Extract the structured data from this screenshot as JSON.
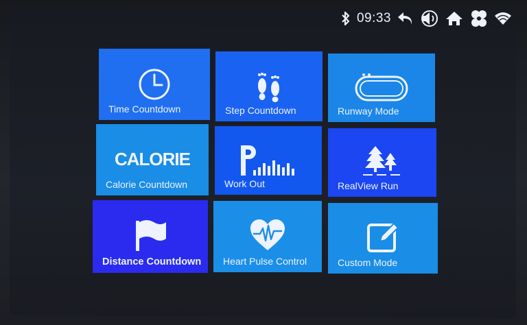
{
  "status_bar": {
    "time": "09:33",
    "icons": [
      "bluetooth-icon",
      "back-icon",
      "volume-icon",
      "home-icon",
      "fan-icon",
      "wifi-icon"
    ]
  },
  "tiles": [
    {
      "label": "Time Countdown",
      "icon": "clock-icon",
      "color": "#1f6ff0"
    },
    {
      "label": "Step Countdown",
      "icon": "footprints-icon",
      "color": "#1a62f2"
    },
    {
      "label": "Runway Mode",
      "icon": "track-icon",
      "color": "#1b86e8"
    },
    {
      "label": "Calorie Countdown",
      "icon": "calorie-icon",
      "icon_text": "CALORIE",
      "color": "#1a8de6"
    },
    {
      "label": "Work Out",
      "icon": "program-bars-icon",
      "color": "#1358ee"
    },
    {
      "label": "RealView Run",
      "icon": "trees-icon",
      "color": "#1b46f2"
    },
    {
      "label": "Distance Countdown",
      "icon": "flag-icon",
      "color": "#2a2bef"
    },
    {
      "label": "Heart Pulse Control",
      "icon": "heart-pulse-icon",
      "color": "#1b8ee8"
    },
    {
      "label": "Custom Mode",
      "icon": "edit-icon",
      "color": "#1a8de6"
    }
  ]
}
